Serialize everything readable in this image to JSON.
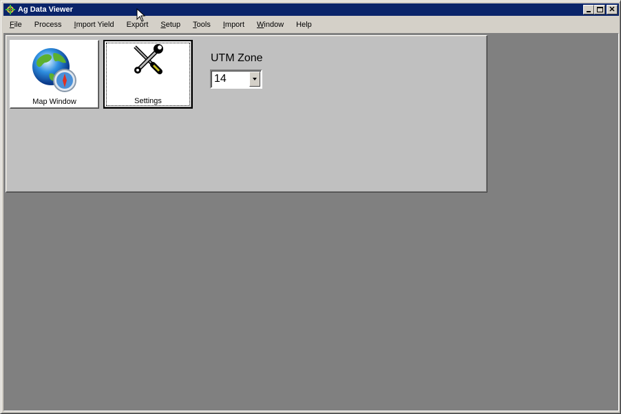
{
  "window": {
    "title": "Ag Data Viewer",
    "app_icon": "crosshair-icon",
    "controls": [
      "minimize",
      "maximize",
      "close"
    ]
  },
  "menu": {
    "items": [
      {
        "label": "File",
        "underline": true
      },
      {
        "label": "Process",
        "underline": false
      },
      {
        "label": "Import Yield",
        "underline": true
      },
      {
        "label": "Export",
        "underline": false
      },
      {
        "label": "Setup",
        "underline": true
      },
      {
        "label": "Tools",
        "underline": true
      },
      {
        "label": "Import",
        "underline": true
      },
      {
        "label": "Window",
        "underline": true
      },
      {
        "label": "Help",
        "underline": false
      }
    ]
  },
  "panel": {
    "map_button": {
      "label": "Map Window",
      "icon": "globe-compass-icon"
    },
    "settings_button": {
      "label": "Settings",
      "icon": "wrench-screwdriver-icon"
    },
    "utm": {
      "label": "UTM Zone",
      "value": "14"
    }
  },
  "colors": {
    "titlebar": "#0a246a",
    "mdi_background": "#808080",
    "panel": "#c0c0c0"
  }
}
